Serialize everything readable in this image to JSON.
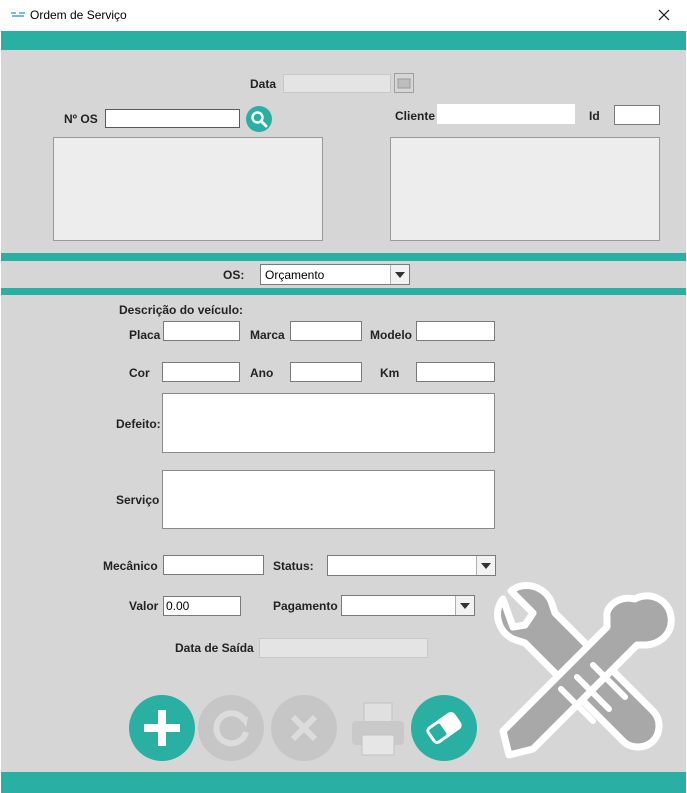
{
  "window": {
    "title": "Ordem de Serviço"
  },
  "header": {
    "data_label": "Data",
    "os_number_label": "Nº OS",
    "client_label": "Cliente",
    "id_label": "Id"
  },
  "os_type": {
    "label": "OS:",
    "selected": "Orçamento"
  },
  "vehicle": {
    "section_label": "Descrição do veículo:",
    "placa_label": "Placa",
    "marca_label": "Marca",
    "modelo_label": "Modelo",
    "cor_label": "Cor",
    "ano_label": "Ano",
    "km_label": "Km",
    "defeito_label": "Defeito:",
    "servico_label": "Serviço"
  },
  "service": {
    "mecanico_label": "Mecânico",
    "status_label": "Status:",
    "valor_label": "Valor",
    "valor_value": "0.00",
    "pagamento_label": "Pagamento",
    "data_saida_label": "Data de Saída"
  },
  "icons": {
    "add": "plus-icon",
    "update": "refresh-icon",
    "delete": "x-icon",
    "print": "printer-icon",
    "clear": "eraser-icon",
    "search": "search-icon",
    "calendar": "calendar-icon",
    "watermark": "wrench-spatula-icon"
  },
  "colors": {
    "accent": "#2aafa3",
    "panel": "#d6d6d6",
    "disabled_button": "#c6c6c6"
  }
}
